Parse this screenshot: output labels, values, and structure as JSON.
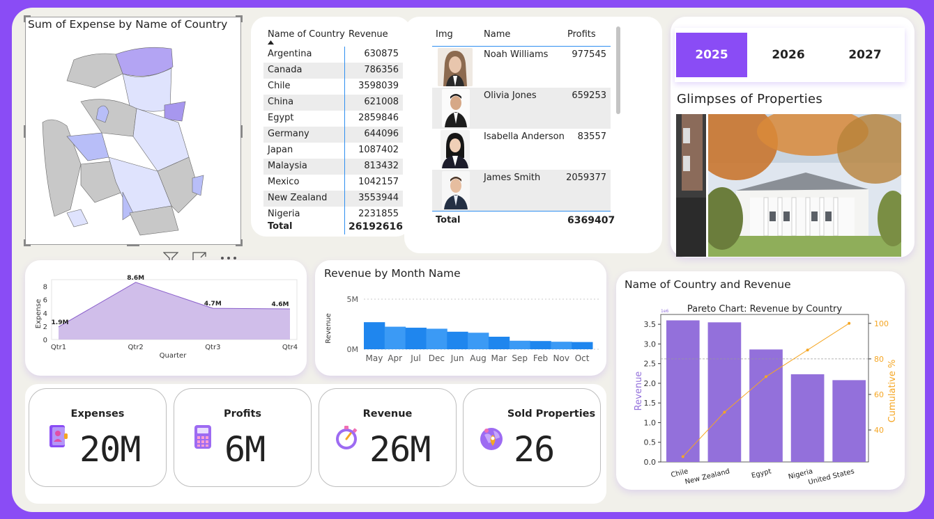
{
  "map": {
    "title": "Sum of Expense by Name of Country"
  },
  "visual_toolbar": {
    "filter_icon": "filter-icon",
    "focus_icon": "focus-mode-icon",
    "more_icon": "more-options-icon"
  },
  "revenue_table": {
    "columns": [
      "Name of Country",
      "Revenue"
    ],
    "rows": [
      {
        "country": "Argentina",
        "revenue": "630875"
      },
      {
        "country": "Canada",
        "revenue": "786356"
      },
      {
        "country": "Chile",
        "revenue": "3598039"
      },
      {
        "country": "China",
        "revenue": "621008"
      },
      {
        "country": "Egypt",
        "revenue": "2859846"
      },
      {
        "country": "Germany",
        "revenue": "644096"
      },
      {
        "country": "Japan",
        "revenue": "1087402"
      },
      {
        "country": "Malaysia",
        "revenue": "813432"
      },
      {
        "country": "Mexico",
        "revenue": "1042157"
      },
      {
        "country": "New Zealand",
        "revenue": "3553944"
      },
      {
        "country": "Nigeria",
        "revenue": "2231855"
      }
    ],
    "total_label": "Total",
    "total_value": "26192616"
  },
  "profits_table": {
    "columns": [
      "Img",
      "Name",
      "Profits"
    ],
    "rows": [
      {
        "name": "Noah Williams",
        "profits": "977545"
      },
      {
        "name": "Olivia Jones",
        "profits": "659253"
      },
      {
        "name": "Isabella Anderson",
        "profits": "83557"
      },
      {
        "name": "James Smith",
        "profits": "2059377"
      }
    ],
    "total_label": "Total",
    "total_value": "6369407"
  },
  "years": {
    "options": [
      "2025",
      "2026",
      "2027"
    ],
    "selected": "2025",
    "accent": "#8a4cf5"
  },
  "gallery": {
    "title": "Glimpses of Properties"
  },
  "expense_chart": {
    "chart_data": {
      "type": "area",
      "categories": [
        "Qtr1",
        "Qtr2",
        "Qtr3",
        "Qtr4"
      ],
      "values": [
        1.9,
        8.6,
        4.7,
        4.6
      ],
      "data_labels": [
        "1.9M",
        "8.6M",
        "4.7M",
        "4.6M"
      ],
      "xlabel": "Quarter",
      "ylabel": "Expense",
      "yticks": [
        "0",
        "2",
        "4",
        "6",
        "8"
      ],
      "ylim": [
        0,
        9
      ],
      "color": "#c8b3e6"
    }
  },
  "month_chart": {
    "title": "Revenue by Month Name",
    "chart_data": {
      "type": "area",
      "categories": [
        "May",
        "Apr",
        "Jul",
        "Dec",
        "Jun",
        "Aug",
        "Mar",
        "Sep",
        "Feb",
        "Nov",
        "Oct"
      ],
      "values": [
        2.7,
        2.25,
        2.15,
        2.05,
        1.75,
        1.65,
        1.25,
        0.85,
        0.82,
        0.75,
        0.72
      ],
      "ylabel": "Revenue",
      "yticks": [
        "0M",
        "5M"
      ],
      "ylim": [
        0,
        5
      ],
      "color": "#2d8ef0"
    }
  },
  "pareto_chart": {
    "title": "Name of Country and Revenue",
    "chart_data": {
      "type": "bar",
      "title": "Pareto Chart: Revenue by Country",
      "categories": [
        "Chile",
        "New Zealand",
        "Egypt",
        "Nigeria",
        "United States"
      ],
      "values": [
        3.6,
        3.55,
        2.86,
        2.23,
        2.08
      ],
      "cumulative": [
        25,
        50,
        70,
        85,
        100
      ],
      "xlabel": "",
      "ylabel": "Revenue",
      "y2label": "Cumulative %",
      "scale_note": "1e6",
      "yticks": [
        "0.0",
        "0.5",
        "1.0",
        "1.5",
        "2.0",
        "2.5",
        "3.0",
        "3.5"
      ],
      "y2ticks": [
        "40",
        "60",
        "80",
        "100"
      ],
      "ylim": [
        0,
        3.75
      ],
      "y2lim": [
        22,
        105
      ],
      "threshold": 80,
      "bar_color": "#9370db",
      "line_color": "#f5a623"
    }
  },
  "kpis": [
    {
      "label": "Expenses",
      "value": "20M"
    },
    {
      "label": "Profits",
      "value": "6M"
    },
    {
      "label": "Revenue",
      "value": "26M"
    },
    {
      "label": "Sold Properties",
      "value": "26"
    }
  ]
}
